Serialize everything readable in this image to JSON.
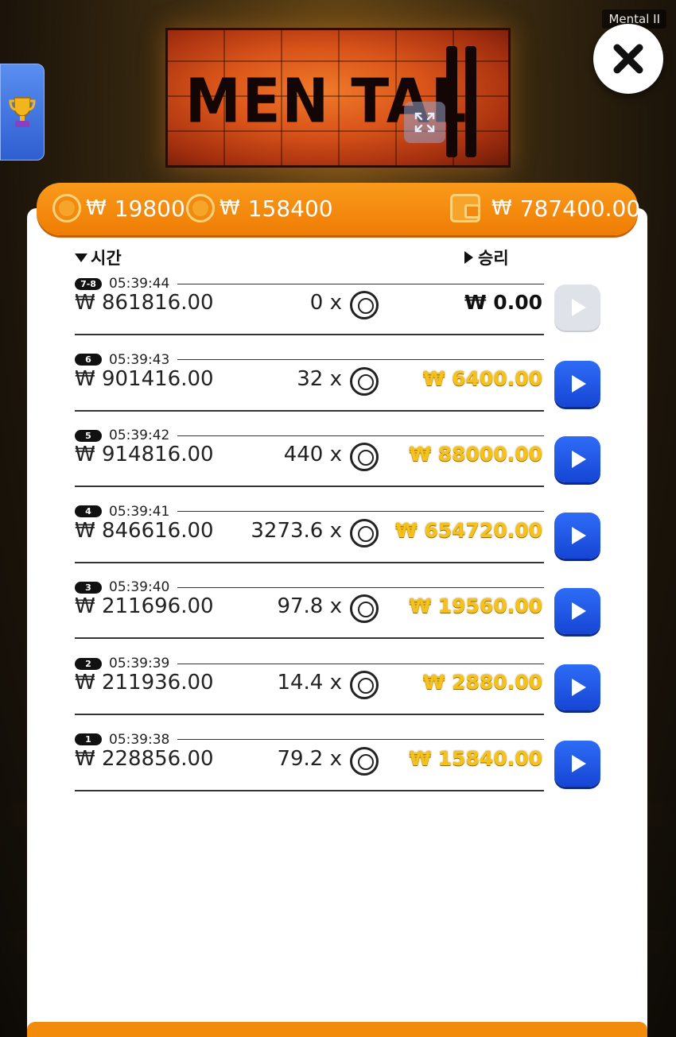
{
  "window": {
    "title": "Mental II"
  },
  "game": {
    "logo_text": "MEN TAL"
  },
  "balance_bar": {
    "currency": "₩",
    "bet_amount": "19800",
    "total_bet": "158400",
    "wallet_balance": "787400.00"
  },
  "history": {
    "col_time_label": "시간",
    "col_win_label": "승리",
    "rows": [
      {
        "badge": "7-8",
        "time": "05:39:44",
        "bet": "₩ 861816.00",
        "multiplier": "0 x",
        "win": "₩ 0.00",
        "replay_enabled": false
      },
      {
        "badge": "6",
        "time": "05:39:43",
        "bet": "₩ 901416.00",
        "multiplier": "32 x",
        "win": "₩ 6400.00",
        "replay_enabled": true
      },
      {
        "badge": "5",
        "time": "05:39:42",
        "bet": "₩ 914816.00",
        "multiplier": "440 x",
        "win": "₩ 88000.00",
        "replay_enabled": true
      },
      {
        "badge": "4",
        "time": "05:39:41",
        "bet": "₩ 846616.00",
        "multiplier": "3273.6 x",
        "win": "₩ 654720.00",
        "replay_enabled": true
      },
      {
        "badge": "3",
        "time": "05:39:40",
        "bet": "₩ 211696.00",
        "multiplier": "97.8 x",
        "win": "₩ 19560.00",
        "replay_enabled": true
      },
      {
        "badge": "2",
        "time": "05:39:39",
        "bet": "₩ 211936.00",
        "multiplier": "14.4 x",
        "win": "₩ 2880.00",
        "replay_enabled": true
      },
      {
        "badge": "1",
        "time": "05:39:38",
        "bet": "₩ 228856.00",
        "multiplier": "79.2 x",
        "win": "₩ 15840.00",
        "replay_enabled": true
      }
    ]
  },
  "colors": {
    "accent": "#f28a0c",
    "replay_button": "#1f55e0",
    "win_gold": "#f5c21a"
  },
  "icons": [
    "trophy-icon",
    "expand-icon",
    "close-icon",
    "coin-icon",
    "wallet-icon",
    "play-icon",
    "sort-down-icon",
    "sort-right-icon"
  ]
}
